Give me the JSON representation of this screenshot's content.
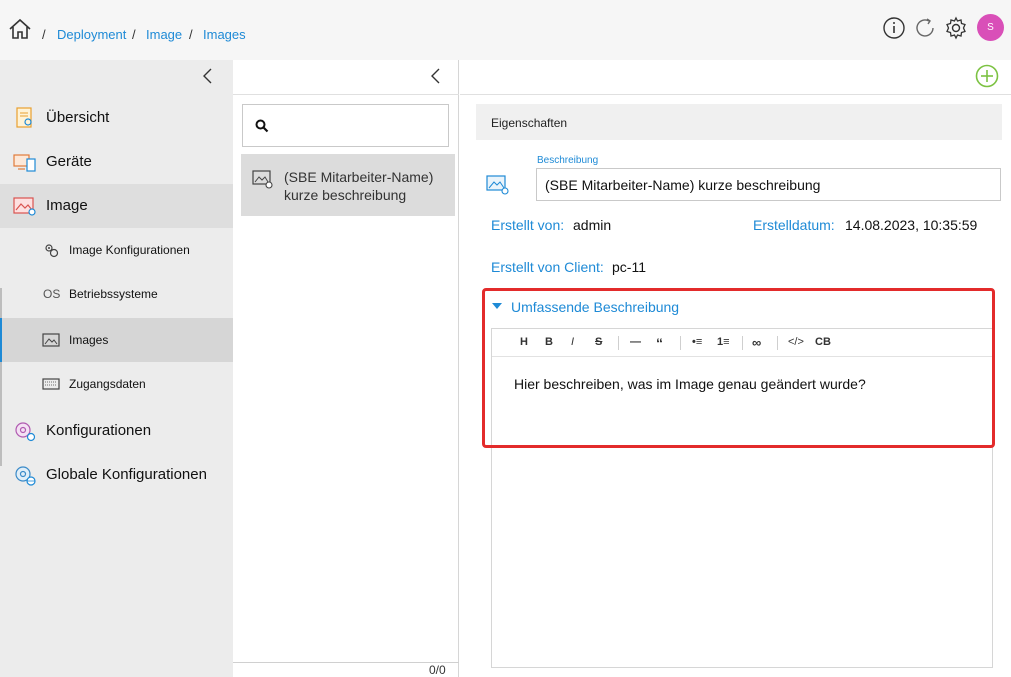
{
  "breadcrumb": {
    "items": [
      "Deployment",
      "Image",
      "Images"
    ],
    "separator": "/"
  },
  "header": {
    "avatar_letter": "S",
    "icons": [
      "info-icon",
      "refresh-icon",
      "settings-icon"
    ]
  },
  "sidebar": {
    "items": [
      {
        "label": "Übersicht",
        "icon": "overview-icon"
      },
      {
        "label": "Geräte",
        "icon": "devices-icon"
      },
      {
        "label": "Image",
        "icon": "image-icon",
        "active": true
      },
      {
        "label": "Konfigurationen",
        "icon": "configurations-icon"
      },
      {
        "label": "Globale Konfigurationen",
        "icon": "global-configurations-icon"
      }
    ],
    "subitems": [
      {
        "label": "Image Konfigurationen",
        "icon": "image-config-icon"
      },
      {
        "label": "Betriebssysteme",
        "prefix": "OS"
      },
      {
        "label": "Images",
        "icon": "images-icon",
        "active": true
      },
      {
        "label": "Zugangsdaten",
        "icon": "credentials-icon"
      }
    ]
  },
  "list": {
    "search_placeholder": "",
    "items": [
      {
        "label": "(SBE Mitarbeiter-Name) kurze beschreibung"
      }
    ],
    "counter": "0/0"
  },
  "details": {
    "section_title": "Eigenschaften",
    "description_label": "Beschreibung",
    "description_value": "(SBE Mitarbeiter-Name) kurze beschreibung",
    "created_by_label": "Erstellt von:",
    "created_by_value": "admin",
    "created_date_label": "Erstelldatum:",
    "created_date_value": "14.08.2023, 10:35:59",
    "created_client_label": "Erstellt von Client:",
    "created_client_value": "pc-11",
    "accordion_title": "Umfassende Beschreibung",
    "editor_text": "Hier beschreiben, was im Image genau geändert wurde?",
    "toolbar": [
      "H",
      "B",
      "I",
      "S",
      "—",
      "“",
      "•≡",
      "1≡",
      "∞",
      "</>",
      "CB"
    ]
  },
  "colors": {
    "accent": "#1e8ad6",
    "highlight": "#e32b2b",
    "avatar": "#d94fb8",
    "add": "#7cc242"
  }
}
